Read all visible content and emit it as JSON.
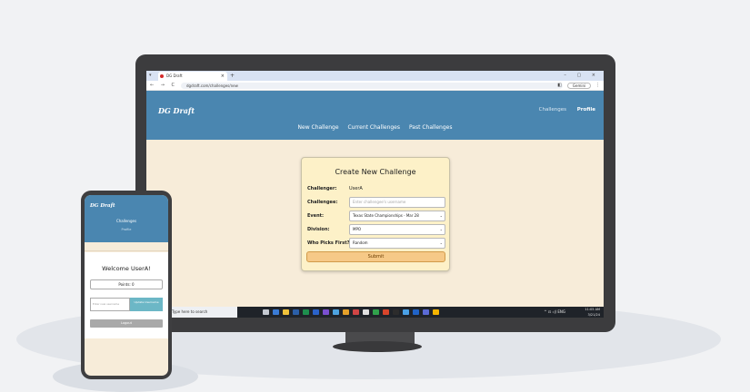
{
  "browser": {
    "tab_title": "DG Draft",
    "tab_close": "×",
    "new_tab": "+",
    "url": "dgdraft.com/challenges/new",
    "nav_buttons": "← → C",
    "gemini_label": "Gemini",
    "window_controls": "– ▢ ×"
  },
  "app": {
    "brand": "DG Draft",
    "top_nav": {
      "challenges": "Challenges",
      "profile": "Profile"
    },
    "sub_nav": {
      "new_challenge": "New Challenge",
      "current_challenges": "Current Challenges",
      "past_challenges": "Past Challenges"
    }
  },
  "form": {
    "title": "Create New Challenge",
    "challenger_label": "Challenger:",
    "challenger_value": "UserA",
    "challengee_label": "Challengee:",
    "challengee_placeholder": "Enter challengee's username",
    "event_label": "Event:",
    "event_value": "Texas State Championships - Mar 28",
    "division_label": "Division:",
    "division_value": "MPO",
    "first_label": "Who Picks First?",
    "first_value": "Random",
    "submit_label": "Submit"
  },
  "taskbar": {
    "search_placeholder": "Type here to search",
    "tray_left": "^ ⊡ ◁) ENG",
    "time": "11:05 AM",
    "date": "3/21/24",
    "icon_colors": [
      "#c4c9d1",
      "#3a7bd5",
      "#f0c23b",
      "#2b5fa8",
      "#1e8f4e",
      "#2a62c9",
      "#7a4fd0",
      "#4da3e0",
      "#e4a02a",
      "#d04545",
      "#e0e0e0",
      "#31a24c",
      "#d8452b",
      "#2c2c2c",
      "#4aa0e6",
      "#2063c7",
      "#5b6bd6",
      "#f5b400"
    ]
  },
  "phone": {
    "brand": "DG Draft",
    "challenges": "Challenges",
    "profile": "Profile",
    "welcome": "Welcome UserA!",
    "points": "Points: 0",
    "search_placeholder": "Enter new username",
    "challenge_button": "Update Username",
    "logout": "Logout"
  }
}
